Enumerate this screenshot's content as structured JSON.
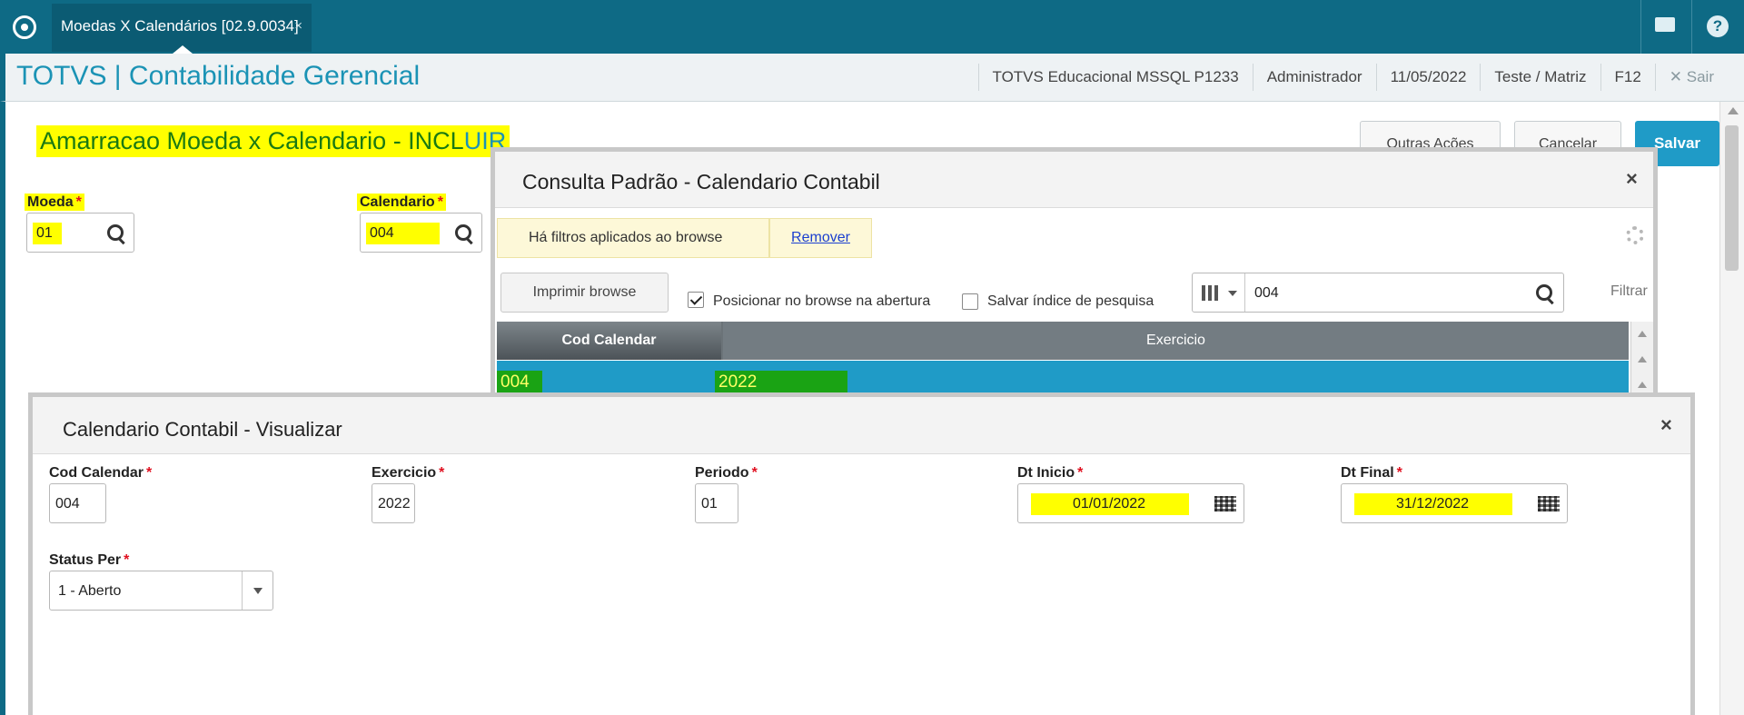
{
  "topbar": {
    "tab_label": "Moedas X Calendários [02.9.0034]",
    "tab_close": "×",
    "mail_icon": "mail-icon",
    "help_icon": "help-icon",
    "help_glyph": "?"
  },
  "app": {
    "title": "TOTVS | Contabilidade Gerencial",
    "info": [
      "TOTVS Educacional MSSQL P1233",
      "Administrador",
      "11/05/2022",
      "Teste / Matriz",
      "F12"
    ],
    "exit_label": "✕ Sair"
  },
  "form": {
    "title_main": "Amarracao Moeda x Calendario - INCL",
    "title_tail": "UIR",
    "actions": {
      "other": "Outras Ações",
      "cancel": "Cancelar",
      "save": "Salvar"
    },
    "fields": {
      "moeda": {
        "label": "Moeda",
        "value": "01"
      },
      "calendario": {
        "label": "Calendario",
        "value": "004"
      }
    },
    "required_mark": "*"
  },
  "lookup": {
    "title": "Consulta Padrão - Calendario Contabil",
    "close": "×",
    "filter_note": "Há filtros aplicados ao browse",
    "filter_remove": "Remover",
    "print": "Imprimir browse",
    "opt_position": "Posicionar no browse na abertura",
    "opt_save_index": "Salvar índice de pesquisa",
    "search_value": "004",
    "filter_label": "Filtrar",
    "columns": [
      "Cod Calendar",
      "Exercicio"
    ],
    "rows": [
      {
        "cod": "004",
        "exercicio": "2022"
      }
    ]
  },
  "view": {
    "title": "Calendario Contabil - Visualizar",
    "close": "×",
    "fields": {
      "cod": {
        "label": "Cod Calendar",
        "value": "004"
      },
      "exercicio": {
        "label": "Exercicio",
        "value": "2022"
      },
      "periodo": {
        "label": "Periodo",
        "value": "01"
      },
      "dt_inicio": {
        "label": "Dt Inicio",
        "value": "01/01/2022"
      },
      "dt_final": {
        "label": "Dt Final",
        "value": "31/12/2022"
      },
      "status": {
        "label": "Status Per",
        "value": "1 - Aberto"
      }
    },
    "required_mark": "*"
  },
  "colors": {
    "brand": "#0e6a85",
    "accent": "#1f9bc7",
    "highlight": "#ffff00",
    "row_highlight": "#1aa314"
  }
}
